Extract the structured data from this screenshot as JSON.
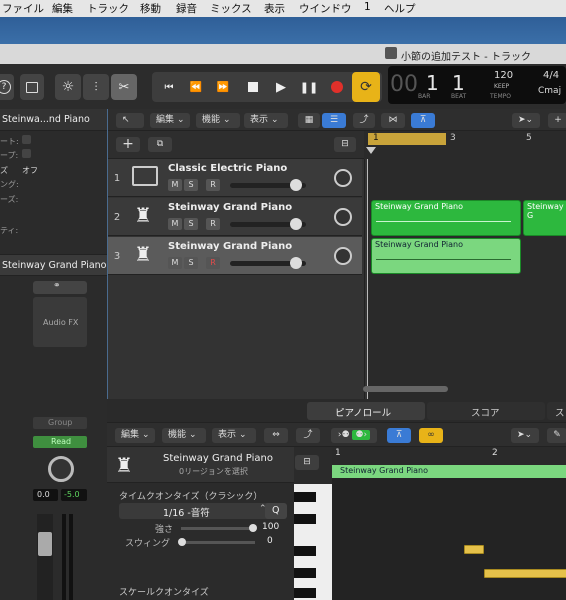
{
  "menu": [
    "ファイル",
    "編集",
    "トラック",
    "移動",
    "録音",
    "ミックス",
    "表示",
    "ウインドウ",
    "1",
    "ヘルプ"
  ],
  "window_title": "小節の追加テスト - トラック",
  "lcd": {
    "bar": "1",
    "beat": "1",
    "bar_label": "BAR",
    "beat_label": "BEAT",
    "tempo": "120",
    "keep": "KEEP",
    "tempo_label": "TEMPO",
    "sig": "4/4",
    "key": "Cmaj"
  },
  "inspector": {
    "region_title": "Steinwa...nd Piano",
    "rows": [
      "ート:",
      "ープ:",
      "ズ",
      "オフ",
      "ング:",
      "ーズ:",
      "ティ:"
    ],
    "track_name": "Steinway Grand Piano",
    "audio_fx": "Audio FX",
    "group": "Group",
    "read": "Read",
    "vol1": "0.0",
    "vol2": "-5.0"
  },
  "tracks_toolbar": {
    "edit": "編集",
    "func": "機能",
    "view": "表示",
    "ruler": [
      "1",
      "3",
      "5"
    ]
  },
  "tracks": [
    {
      "num": "1",
      "name": "Classic Electric Piano",
      "m": "M",
      "s": "S",
      "r": "R"
    },
    {
      "num": "2",
      "name": "Steinway Grand Piano",
      "m": "M",
      "s": "S",
      "r": "R"
    },
    {
      "num": "3",
      "name": "Steinway Grand Piano",
      "m": "M",
      "s": "S",
      "r": "R"
    }
  ],
  "regions": [
    {
      "label": "Steinway Grand Piano"
    },
    {
      "label": "Steinway G"
    },
    {
      "label": "Steinway Grand Piano"
    }
  ],
  "editor": {
    "tabs": [
      "ピアノロール",
      "スコア",
      "ス"
    ],
    "edit": "編集",
    "func": "機能",
    "view": "表示",
    "track": "Steinway Grand Piano",
    "sub": "0リージョンを選択",
    "quant_title": "タイムクオンタイズ（クラシック）",
    "quant_value": "1/16 -音符",
    "q": "Q",
    "strength_label": "強さ",
    "strength_value": "100",
    "swing_label": "スウィング",
    "swing_value": "0",
    "scale_title": "スケールクオンタイズ",
    "ruler": [
      "1",
      "2"
    ],
    "region_label": "Steinway Grand Piano"
  },
  "colors": {
    "region_green": "#2db83e",
    "note_yellow": "#e5c14a",
    "accent_blue": "#3a7bd5",
    "read_green": "#3f8f3f"
  }
}
